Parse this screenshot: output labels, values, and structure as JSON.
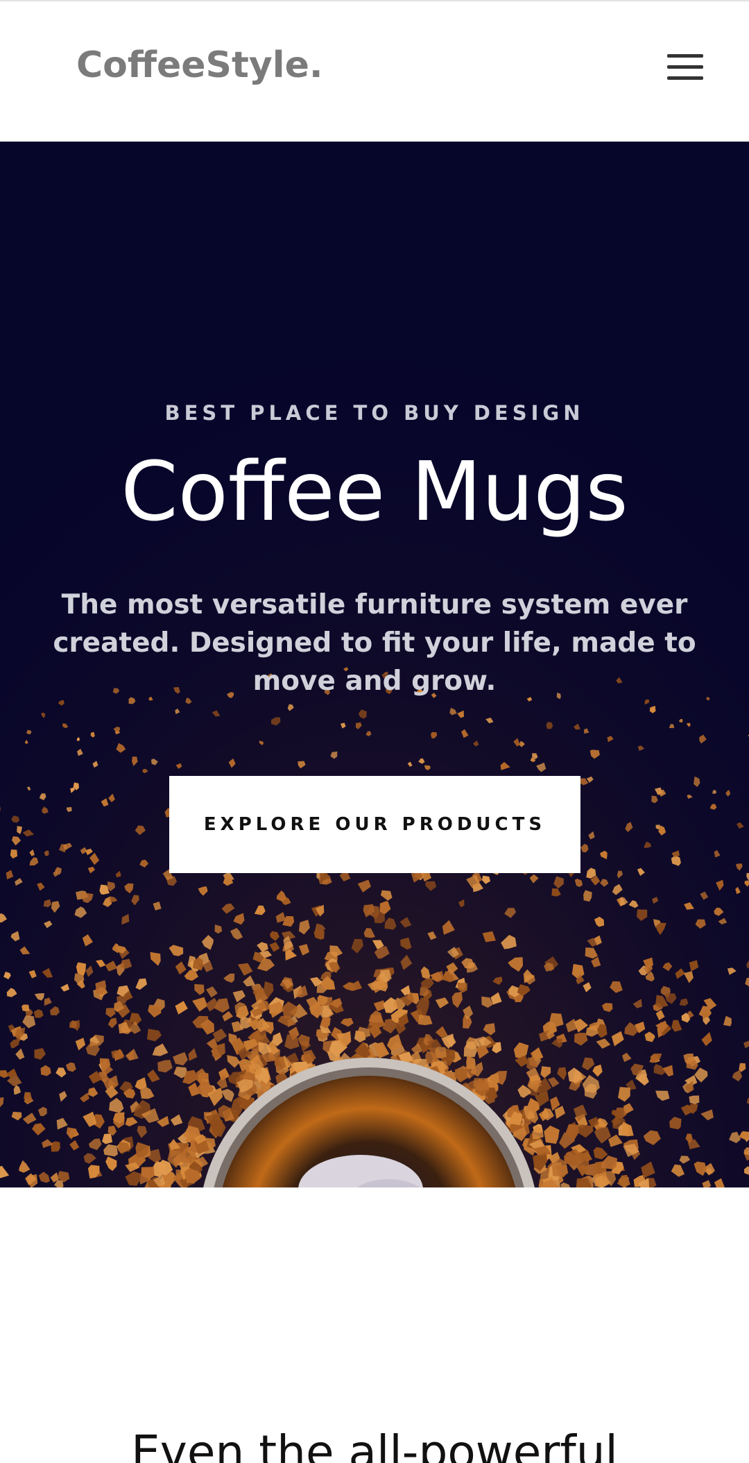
{
  "header": {
    "logo_text": "CoffeeStyle.",
    "menu_icon": "hamburger-menu-icon"
  },
  "hero": {
    "eyebrow": "BEST PLACE TO BUY DESIGN",
    "title": "Coffee Mugs",
    "description": "The most versatile furniture system ever created. Designed to fit your life, made to move and grow.",
    "cta_label": "EXPLORE OUR PRODUCTS",
    "background_color": "#06052a"
  },
  "section": {
    "title": "Even the all-powerful"
  },
  "colors": {
    "logo": "#7b7b7b",
    "hero_background": "#06052a",
    "coffee_granules": "#c77a32",
    "cta_background": "#ffffff"
  }
}
